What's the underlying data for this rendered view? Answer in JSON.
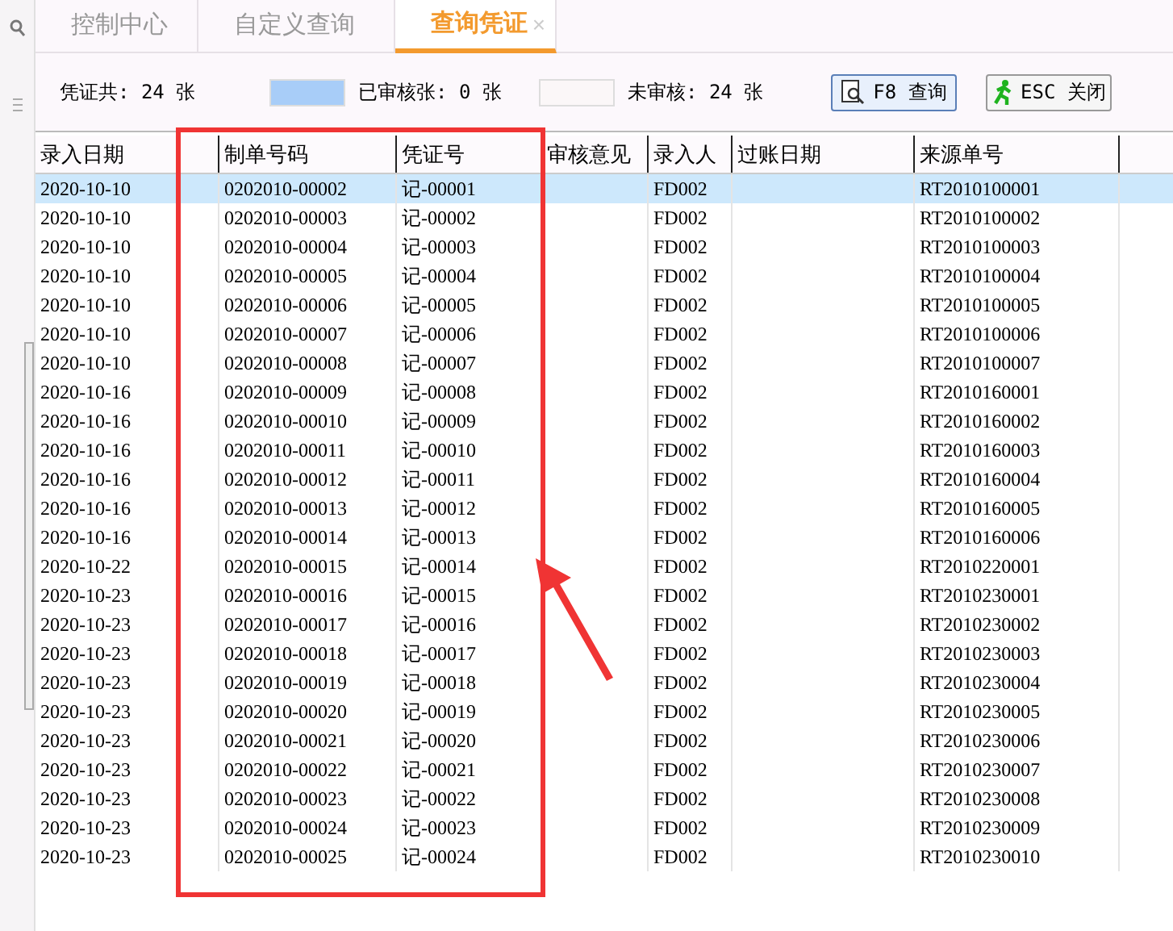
{
  "tabs": [
    {
      "label": "控制中心",
      "selected": false
    },
    {
      "label": "自定义查询",
      "selected": false
    },
    {
      "label": "查询凭证",
      "selected": true,
      "close": "×"
    }
  ],
  "summary": {
    "total": "凭证共: 24 张",
    "legend": [
      {
        "color": "#a8cdf8",
        "label": "已审核张: 0 张"
      },
      {
        "color": "#fbf7f8",
        "label": "未审核: 24 张"
      }
    ]
  },
  "buttons": [
    {
      "kind": "search",
      "label": "F8 查询"
    },
    {
      "kind": "exit",
      "label": "ESC 关闭"
    }
  ],
  "table": {
    "columns": [
      "录入日期",
      "制单号码",
      "凭证号",
      "审核意见",
      "录入人",
      "过账日期",
      "来源单号"
    ],
    "rows": [
      {
        "selected": true,
        "entry_date": "2020-10-10",
        "document_no": "0202010-00002",
        "voucher_no": "记-00001",
        "entered_by": "FD002",
        "source_no": "RT2010100001"
      },
      {
        "selected": false,
        "entry_date": "2020-10-10",
        "document_no": "0202010-00003",
        "voucher_no": "记-00002",
        "entered_by": "FD002",
        "source_no": "RT2010100002"
      },
      {
        "selected": false,
        "entry_date": "2020-10-10",
        "document_no": "0202010-00004",
        "voucher_no": "记-00003",
        "entered_by": "FD002",
        "source_no": "RT2010100003"
      },
      {
        "selected": false,
        "entry_date": "2020-10-10",
        "document_no": "0202010-00005",
        "voucher_no": "记-00004",
        "entered_by": "FD002",
        "source_no": "RT2010100004"
      },
      {
        "selected": false,
        "entry_date": "2020-10-10",
        "document_no": "0202010-00006",
        "voucher_no": "记-00005",
        "entered_by": "FD002",
        "source_no": "RT2010100005"
      },
      {
        "selected": false,
        "entry_date": "2020-10-10",
        "document_no": "0202010-00007",
        "voucher_no": "记-00006",
        "entered_by": "FD002",
        "source_no": "RT2010100006"
      },
      {
        "selected": false,
        "entry_date": "2020-10-10",
        "document_no": "0202010-00008",
        "voucher_no": "记-00007",
        "entered_by": "FD002",
        "source_no": "RT2010100007"
      },
      {
        "selected": false,
        "entry_date": "2020-10-16",
        "document_no": "0202010-00009",
        "voucher_no": "记-00008",
        "entered_by": "FD002",
        "source_no": "RT2010160001"
      },
      {
        "selected": false,
        "entry_date": "2020-10-16",
        "document_no": "0202010-00010",
        "voucher_no": "记-00009",
        "entered_by": "FD002",
        "source_no": "RT2010160002"
      },
      {
        "selected": false,
        "entry_date": "2020-10-16",
        "document_no": "0202010-00011",
        "voucher_no": "记-00010",
        "entered_by": "FD002",
        "source_no": "RT2010160003"
      },
      {
        "selected": false,
        "entry_date": "2020-10-16",
        "document_no": "0202010-00012",
        "voucher_no": "记-00011",
        "entered_by": "FD002",
        "source_no": "RT2010160004"
      },
      {
        "selected": false,
        "entry_date": "2020-10-16",
        "document_no": "0202010-00013",
        "voucher_no": "记-00012",
        "entered_by": "FD002",
        "source_no": "RT2010160005"
      },
      {
        "selected": false,
        "entry_date": "2020-10-16",
        "document_no": "0202010-00014",
        "voucher_no": "记-00013",
        "entered_by": "FD002",
        "source_no": "RT2010160006"
      },
      {
        "selected": false,
        "entry_date": "2020-10-22",
        "document_no": "0202010-00015",
        "voucher_no": "记-00014",
        "entered_by": "FD002",
        "source_no": "RT2010220001"
      },
      {
        "selected": false,
        "entry_date": "2020-10-23",
        "document_no": "0202010-00016",
        "voucher_no": "记-00015",
        "entered_by": "FD002",
        "source_no": "RT2010230001"
      },
      {
        "selected": false,
        "entry_date": "2020-10-23",
        "document_no": "0202010-00017",
        "voucher_no": "记-00016",
        "entered_by": "FD002",
        "source_no": "RT2010230002"
      },
      {
        "selected": false,
        "entry_date": "2020-10-23",
        "document_no": "0202010-00018",
        "voucher_no": "记-00017",
        "entered_by": "FD002",
        "source_no": "RT2010230003"
      },
      {
        "selected": false,
        "entry_date": "2020-10-23",
        "document_no": "0202010-00019",
        "voucher_no": "记-00018",
        "entered_by": "FD002",
        "source_no": "RT2010230004"
      },
      {
        "selected": false,
        "entry_date": "2020-10-23",
        "document_no": "0202010-00020",
        "voucher_no": "记-00019",
        "entered_by": "FD002",
        "source_no": "RT2010230005"
      },
      {
        "selected": false,
        "entry_date": "2020-10-23",
        "document_no": "0202010-00021",
        "voucher_no": "记-00020",
        "entered_by": "FD002",
        "source_no": "RT2010230006"
      },
      {
        "selected": false,
        "entry_date": "2020-10-23",
        "document_no": "0202010-00022",
        "voucher_no": "记-00021",
        "entered_by": "FD002",
        "source_no": "RT2010230007"
      },
      {
        "selected": false,
        "entry_date": "2020-10-23",
        "document_no": "0202010-00023",
        "voucher_no": "记-00022",
        "entered_by": "FD002",
        "source_no": "RT2010230008"
      },
      {
        "selected": false,
        "entry_date": "2020-10-23",
        "document_no": "0202010-00024",
        "voucher_no": "记-00023",
        "entered_by": "FD002",
        "source_no": "RT2010230009"
      },
      {
        "selected": false,
        "entry_date": "2020-10-23",
        "document_no": "0202010-00025",
        "voucher_no": "记-00024",
        "entered_by": "FD002",
        "source_no": "RT2010230010"
      }
    ]
  }
}
